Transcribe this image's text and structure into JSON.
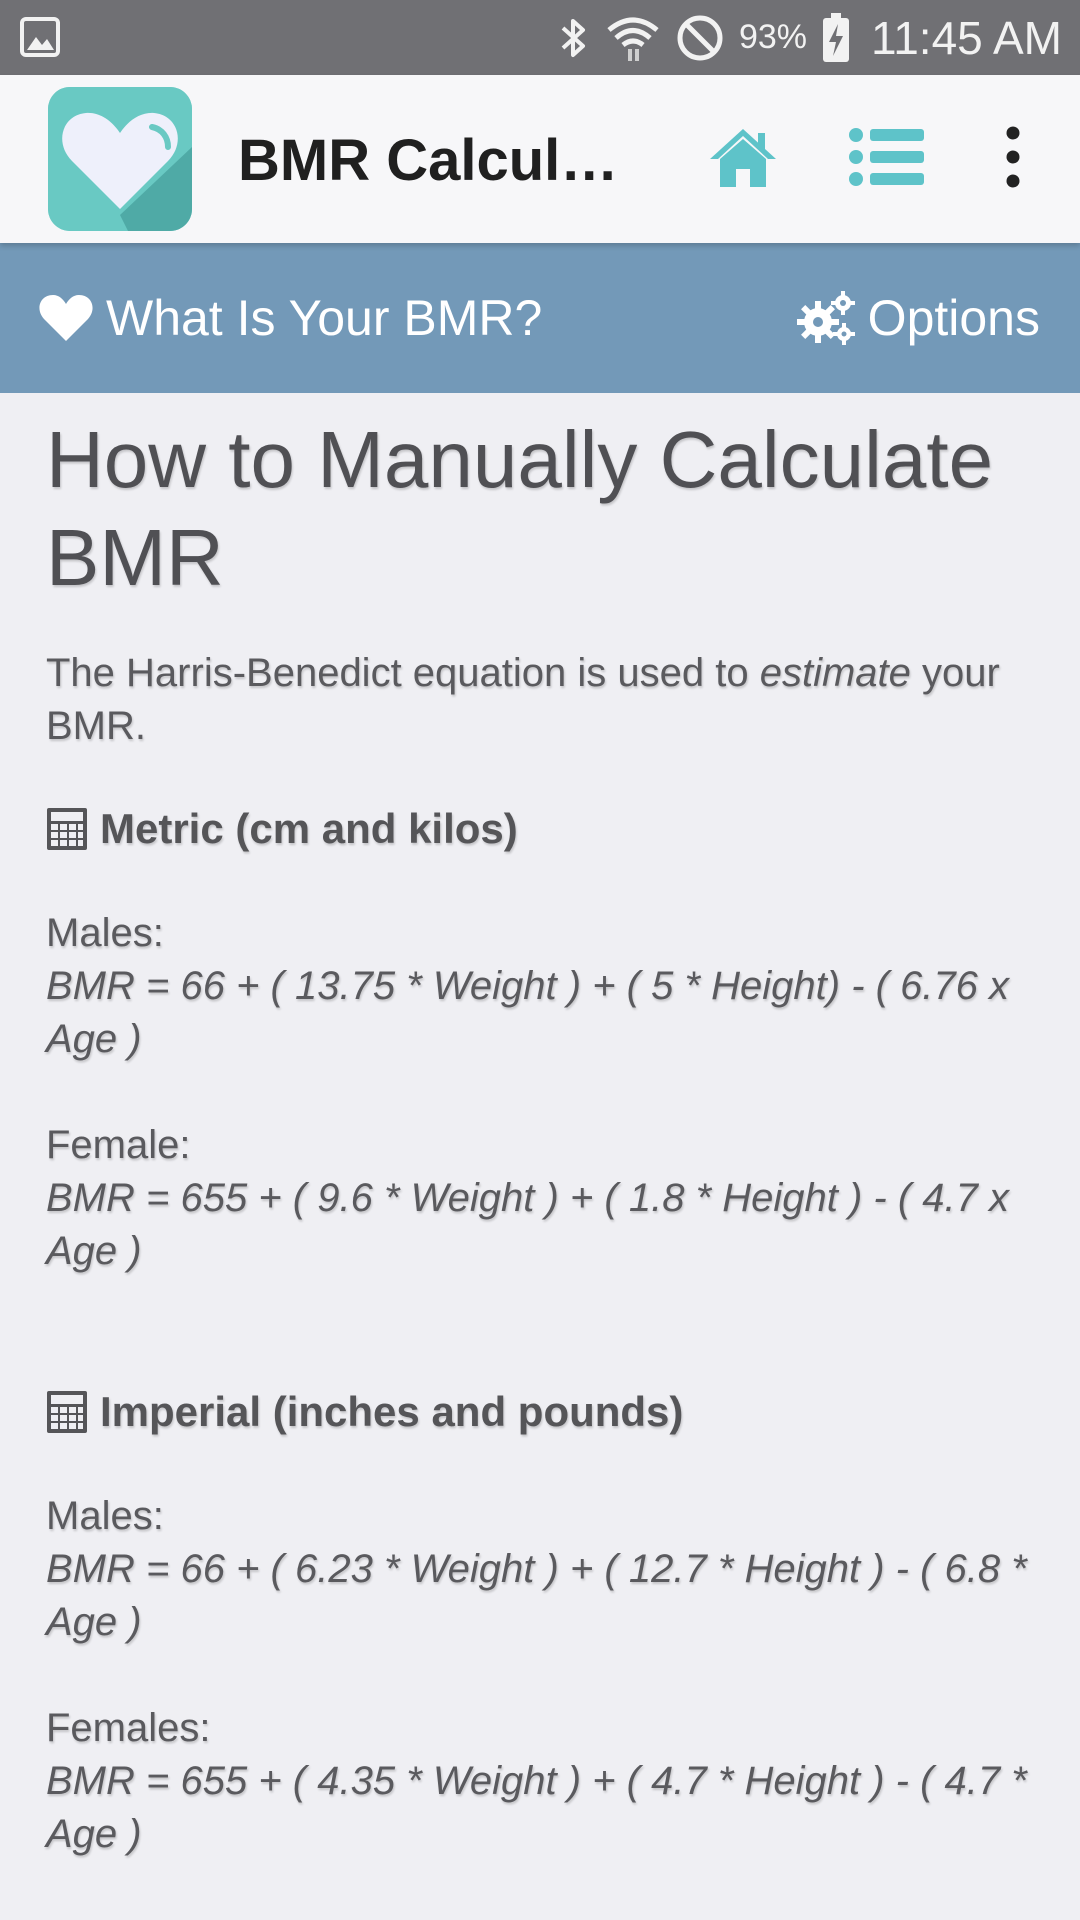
{
  "status_bar": {
    "battery_percent": "93%",
    "time": "11:45 AM"
  },
  "app_bar": {
    "title": "BMR Calculator",
    "icons": {
      "logo": "heart-logo-icon",
      "home": "home-icon",
      "list": "list-icon",
      "overflow": "more-vert-icon"
    }
  },
  "nav": {
    "left_label": "What Is Your BMR?",
    "right_label": "Options"
  },
  "content": {
    "title": "How to Manually Calculate BMR",
    "intro_pre": "The Harris-Benedict equation is used to ",
    "intro_emphasis": "estimate",
    "intro_post": " your BMR.",
    "sections": [
      {
        "heading": "Metric (cm and kilos)",
        "male_label": "Males:",
        "male_formula": "BMR = 66 + ( 13.75 * Weight ) + ( 5 * Height) - ( 6.76 x Age )",
        "female_label": "Female:",
        "female_formula": "BMR = 655 + ( 9.6 * Weight ) + ( 1.8 * Height ) - ( 4.7 x Age )"
      },
      {
        "heading": "Imperial (inches and pounds)",
        "male_label": "Males:",
        "male_formula": "BMR = 66 + ( 6.23 * Weight ) + ( 12.7 * Height ) - ( 6.8 * Age )",
        "female_label": "Females:",
        "female_formula": "BMR = 655 + ( 4.35 * Weight ) + ( 4.7 * Height ) - ( 4.7 * Age )"
      }
    ]
  },
  "colors": {
    "status_bar": "#707074",
    "app_bar": "#f7f7f9",
    "nav_strip": "#7399b8",
    "accent_teal": "#5ec3c9",
    "background": "#efeff3",
    "text": "#555558"
  }
}
